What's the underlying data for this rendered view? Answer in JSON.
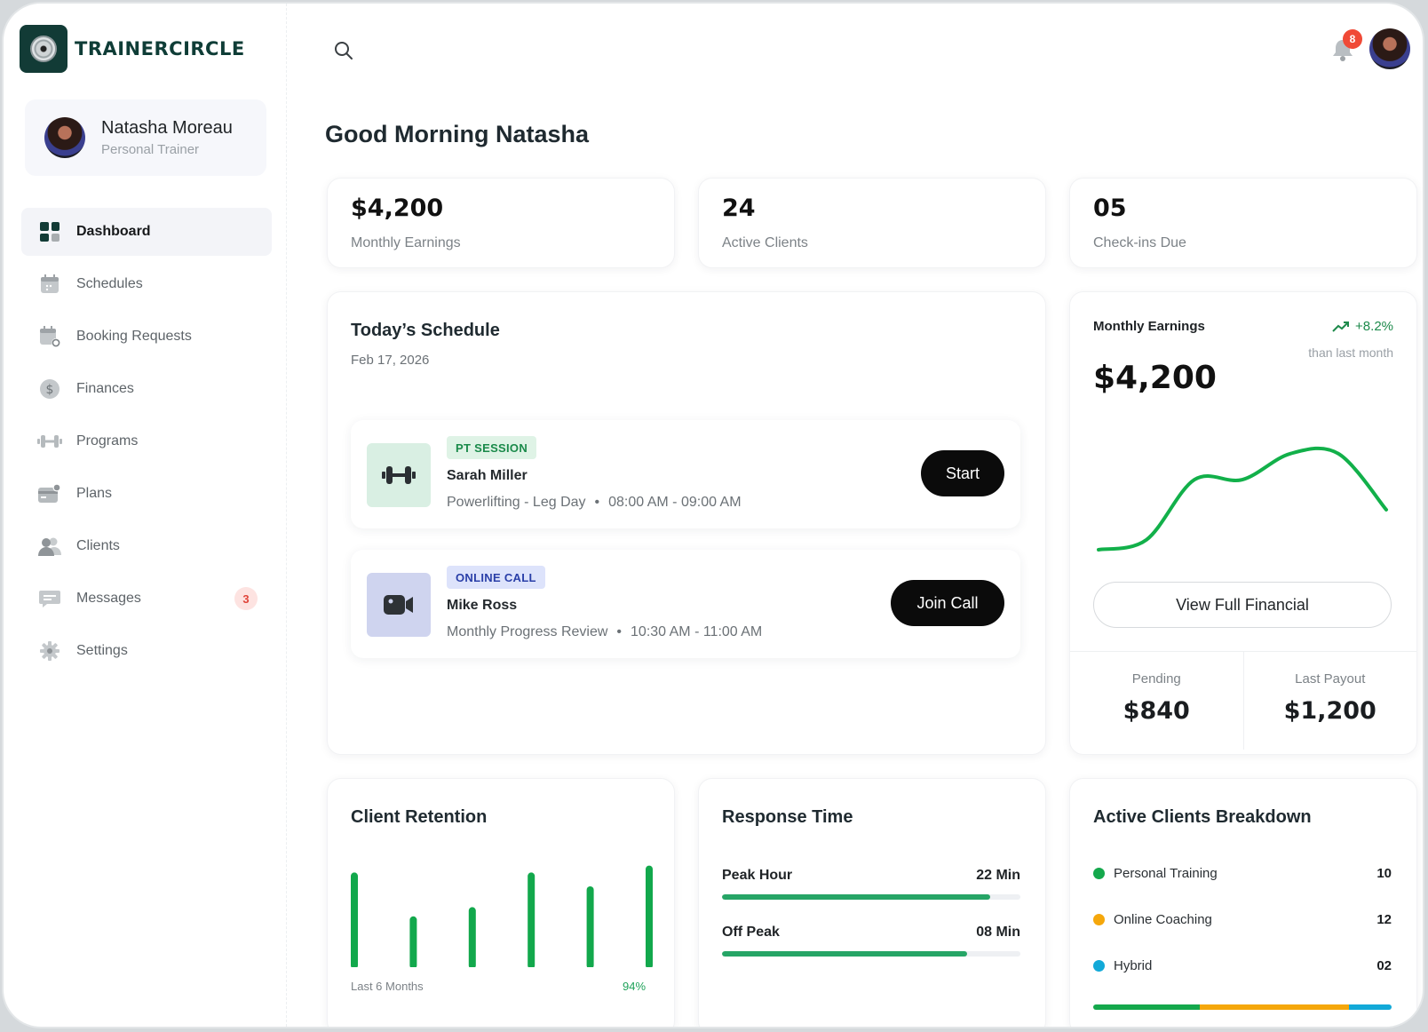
{
  "brand": {
    "name": "TRAINERCIRCLE"
  },
  "profile": {
    "name": "Natasha Moreau",
    "role": "Personal Trainer"
  },
  "nav": [
    {
      "label": "Dashboard",
      "icon": "dashboard-icon",
      "active": true
    },
    {
      "label": "Schedules",
      "icon": "calendar-icon"
    },
    {
      "label": "Booking Requests",
      "icon": "calendar-add-icon"
    },
    {
      "label": "Finances",
      "icon": "dollar-icon"
    },
    {
      "label": "Programs",
      "icon": "dumbbell-icon"
    },
    {
      "label": "Plans",
      "icon": "card-icon"
    },
    {
      "label": "Clients",
      "icon": "users-icon"
    },
    {
      "label": "Messages",
      "icon": "message-icon",
      "badge": "3"
    },
    {
      "label": "Settings",
      "icon": "gear-icon"
    }
  ],
  "topbar": {
    "notification_count": "8"
  },
  "greeting": "Good Morning Natasha",
  "stats": [
    {
      "value": "$4,200",
      "label": "Monthly Earnings"
    },
    {
      "value": "24",
      "label": "Active Clients"
    },
    {
      "value": "05",
      "label": "Check-ins Due"
    }
  ],
  "schedule": {
    "title": "Today’s Schedule",
    "date": "Feb 17, 2026",
    "sessions": [
      {
        "tag": "PT SESSION",
        "client": "Sarah Miller",
        "program": "Powerlifting - Leg Day",
        "time": "08:00 AM - 09:00 AM",
        "action": "Start",
        "icon": "dumbbell-icon"
      },
      {
        "tag": "ONLINE CALL",
        "client": "Mike Ross",
        "program": "Monthly Progress Review",
        "time": "10:30 AM - 11:00 AM",
        "action": "Join Call",
        "icon": "video-camera-icon"
      }
    ]
  },
  "earnings": {
    "title": "Monthly Earnings",
    "change": "+8.2%",
    "change_note": "than last month",
    "value": "$4,200",
    "view_button": "View Full Financial",
    "pending_label": "Pending",
    "pending_value": "$840",
    "payout_label": "Last Payout",
    "payout_value": "$1,200",
    "line_color": "#12b04a"
  },
  "retention": {
    "title": "Client Retention",
    "footer_left": "Last 6 Months",
    "footer_right": "94%"
  },
  "response": {
    "title": "Response Time",
    "rows": [
      {
        "label": "Peak Hour",
        "value": "22 Min",
        "fill": 0.9
      },
      {
        "label": "Off Peak",
        "value": "08 Min",
        "fill": 0.82
      }
    ]
  },
  "breakdown": {
    "title": "Active Clients Breakdown",
    "items": [
      {
        "label": "Personal Training",
        "value": "10",
        "color": "#14a84c"
      },
      {
        "label": "Online Coaching",
        "value": "12",
        "color": "#f5a70b"
      },
      {
        "label": "Hybrid",
        "value": "02",
        "color": "#12a9d8"
      }
    ],
    "bar_segments": [
      {
        "color": "#14a84c",
        "share": 0.357
      },
      {
        "color": "#f5a70b",
        "share": 0.5
      },
      {
        "color": "#12a9d8",
        "share": 0.143
      }
    ]
  },
  "chart_data": [
    {
      "type": "line",
      "title": "Monthly Earnings",
      "x": [
        0,
        1,
        2,
        3,
        4,
        5,
        6
      ],
      "y": [
        0,
        5,
        35,
        35,
        48,
        48,
        20
      ],
      "color": "#12b04a",
      "grid": false
    },
    {
      "type": "bar",
      "title": "Client Retention",
      "categories": [
        "1",
        "2",
        "3",
        "4",
        "5",
        "6"
      ],
      "values": [
        82,
        44,
        52,
        82,
        70,
        88
      ],
      "ylim": [
        0,
        100
      ],
      "color": "#12a84c",
      "grid": false
    }
  ]
}
